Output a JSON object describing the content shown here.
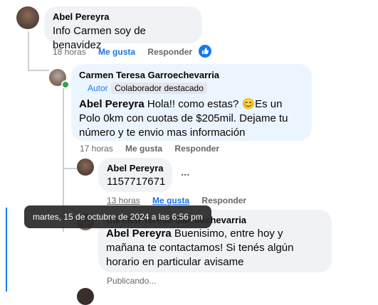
{
  "comment1": {
    "author": "Abel Pereyra",
    "text": "Info Carmen soy de benavidez",
    "time": "18 horas",
    "like_label": "Me gusta",
    "reply_label": "Responder"
  },
  "comment2": {
    "author": "Carmen Teresa Garroechevarria",
    "badge_author": "Autor",
    "badge_contributor": "Colaborador destacado",
    "mention": "Abel Pereyra",
    "text": " Hola!! como estas? 😊Es un Polo 0km con cuotas de $205mil. Dejame tu número y te envio mas información",
    "time": "17 horas",
    "like_label": "Me gusta",
    "reply_label": "Responder"
  },
  "comment3": {
    "author": "Abel Pereyra",
    "text": "1157717671",
    "more": "...",
    "time": "13 horas",
    "like_label": "Me gusta",
    "reply_label": "Responder"
  },
  "comment4": {
    "author": "Carmen Teresa Garroechevarria",
    "mention": "Abel Pereyra",
    "text": " Buenisimo, entre hoy y mañana te contactamos! Si tenés algún horario en particular avisame",
    "status": "Publicando..."
  },
  "tooltip": "martes, 15 de octubre de 2024 a las 6:56 pm",
  "colors": {
    "bubble_gray": "#f0f2f5",
    "bubble_blue": "#ebf5ff",
    "accent": "#1877f2"
  }
}
